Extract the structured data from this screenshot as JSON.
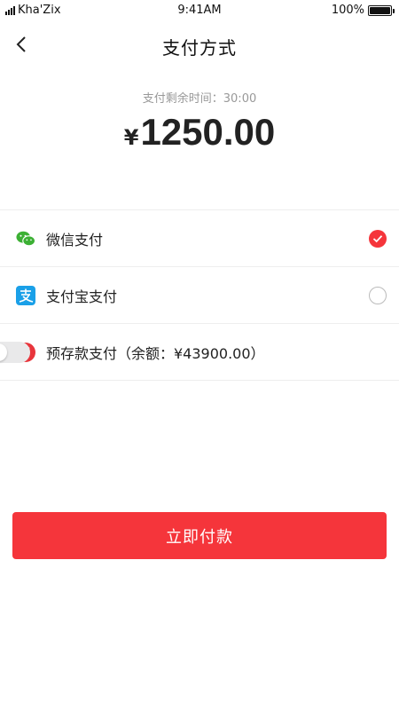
{
  "status_bar": {
    "carrier": "Kha'Zix",
    "time": "9:41AM",
    "battery": "100%"
  },
  "nav": {
    "title": "支付方式",
    "back_icon": "chevron-left-icon"
  },
  "payment": {
    "countdown_label": "支付剩余时间：",
    "countdown_value": "30:00",
    "currency_symbol": "¥",
    "amount": "1250.00"
  },
  "methods": [
    {
      "label": "微信支付",
      "icon": "wechat-icon",
      "icon_color": "#3cb034",
      "selected": true
    },
    {
      "label": "支付宝支付",
      "icon": "alipay-icon",
      "icon_color": "#1aa0e8",
      "selected": false
    },
    {
      "label": "预存款支付（余额：¥43900.00）",
      "icon": "prepaid-yen-icon",
      "icon_color": "#e8353c",
      "toggle_on": false
    }
  ],
  "pay_button": {
    "label": "立即付款"
  },
  "colors": {
    "accent": "#f5353b"
  }
}
